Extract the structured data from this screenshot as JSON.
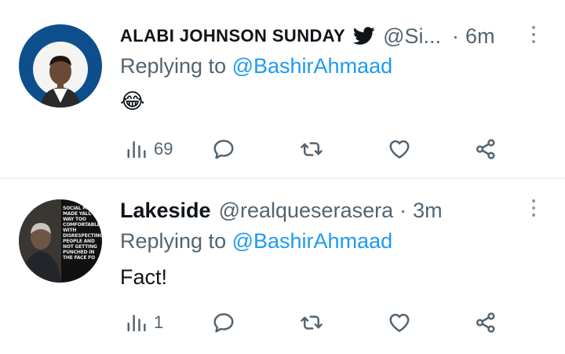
{
  "tweets": [
    {
      "name": "ALABI JOHNSON SUNDAY",
      "handle": "@Si...",
      "time": "6m",
      "replying_prefix": "Replying to",
      "replying_to": "@BashirAhmaad",
      "text": "😂",
      "views": "69"
    },
    {
      "name": "Lakeside",
      "handle": "@realqueserasera",
      "time": "3m",
      "replying_prefix": "Replying to",
      "replying_to": "@BashirAhmaad",
      "text": "Fact!",
      "views": "1"
    }
  ],
  "avatar2_poster_text": [
    "SOCIAL ME",
    "MADE YALL",
    "WAY TOO",
    "COMFORTABLE",
    "WITH",
    "DISRESPECTING",
    "PEOPLE AND",
    "NOT GETTING",
    "PUNCHED IN",
    "THE FACE FO"
  ],
  "colors": {
    "link": "#1d9bf0",
    "muted": "#536471",
    "text": "#0f1419",
    "avatar_bg": "#0d4f8c"
  },
  "icons": [
    "twitter-bird-icon",
    "views-icon",
    "reply-icon",
    "retweet-icon",
    "like-icon",
    "share-icon",
    "more-icon"
  ]
}
